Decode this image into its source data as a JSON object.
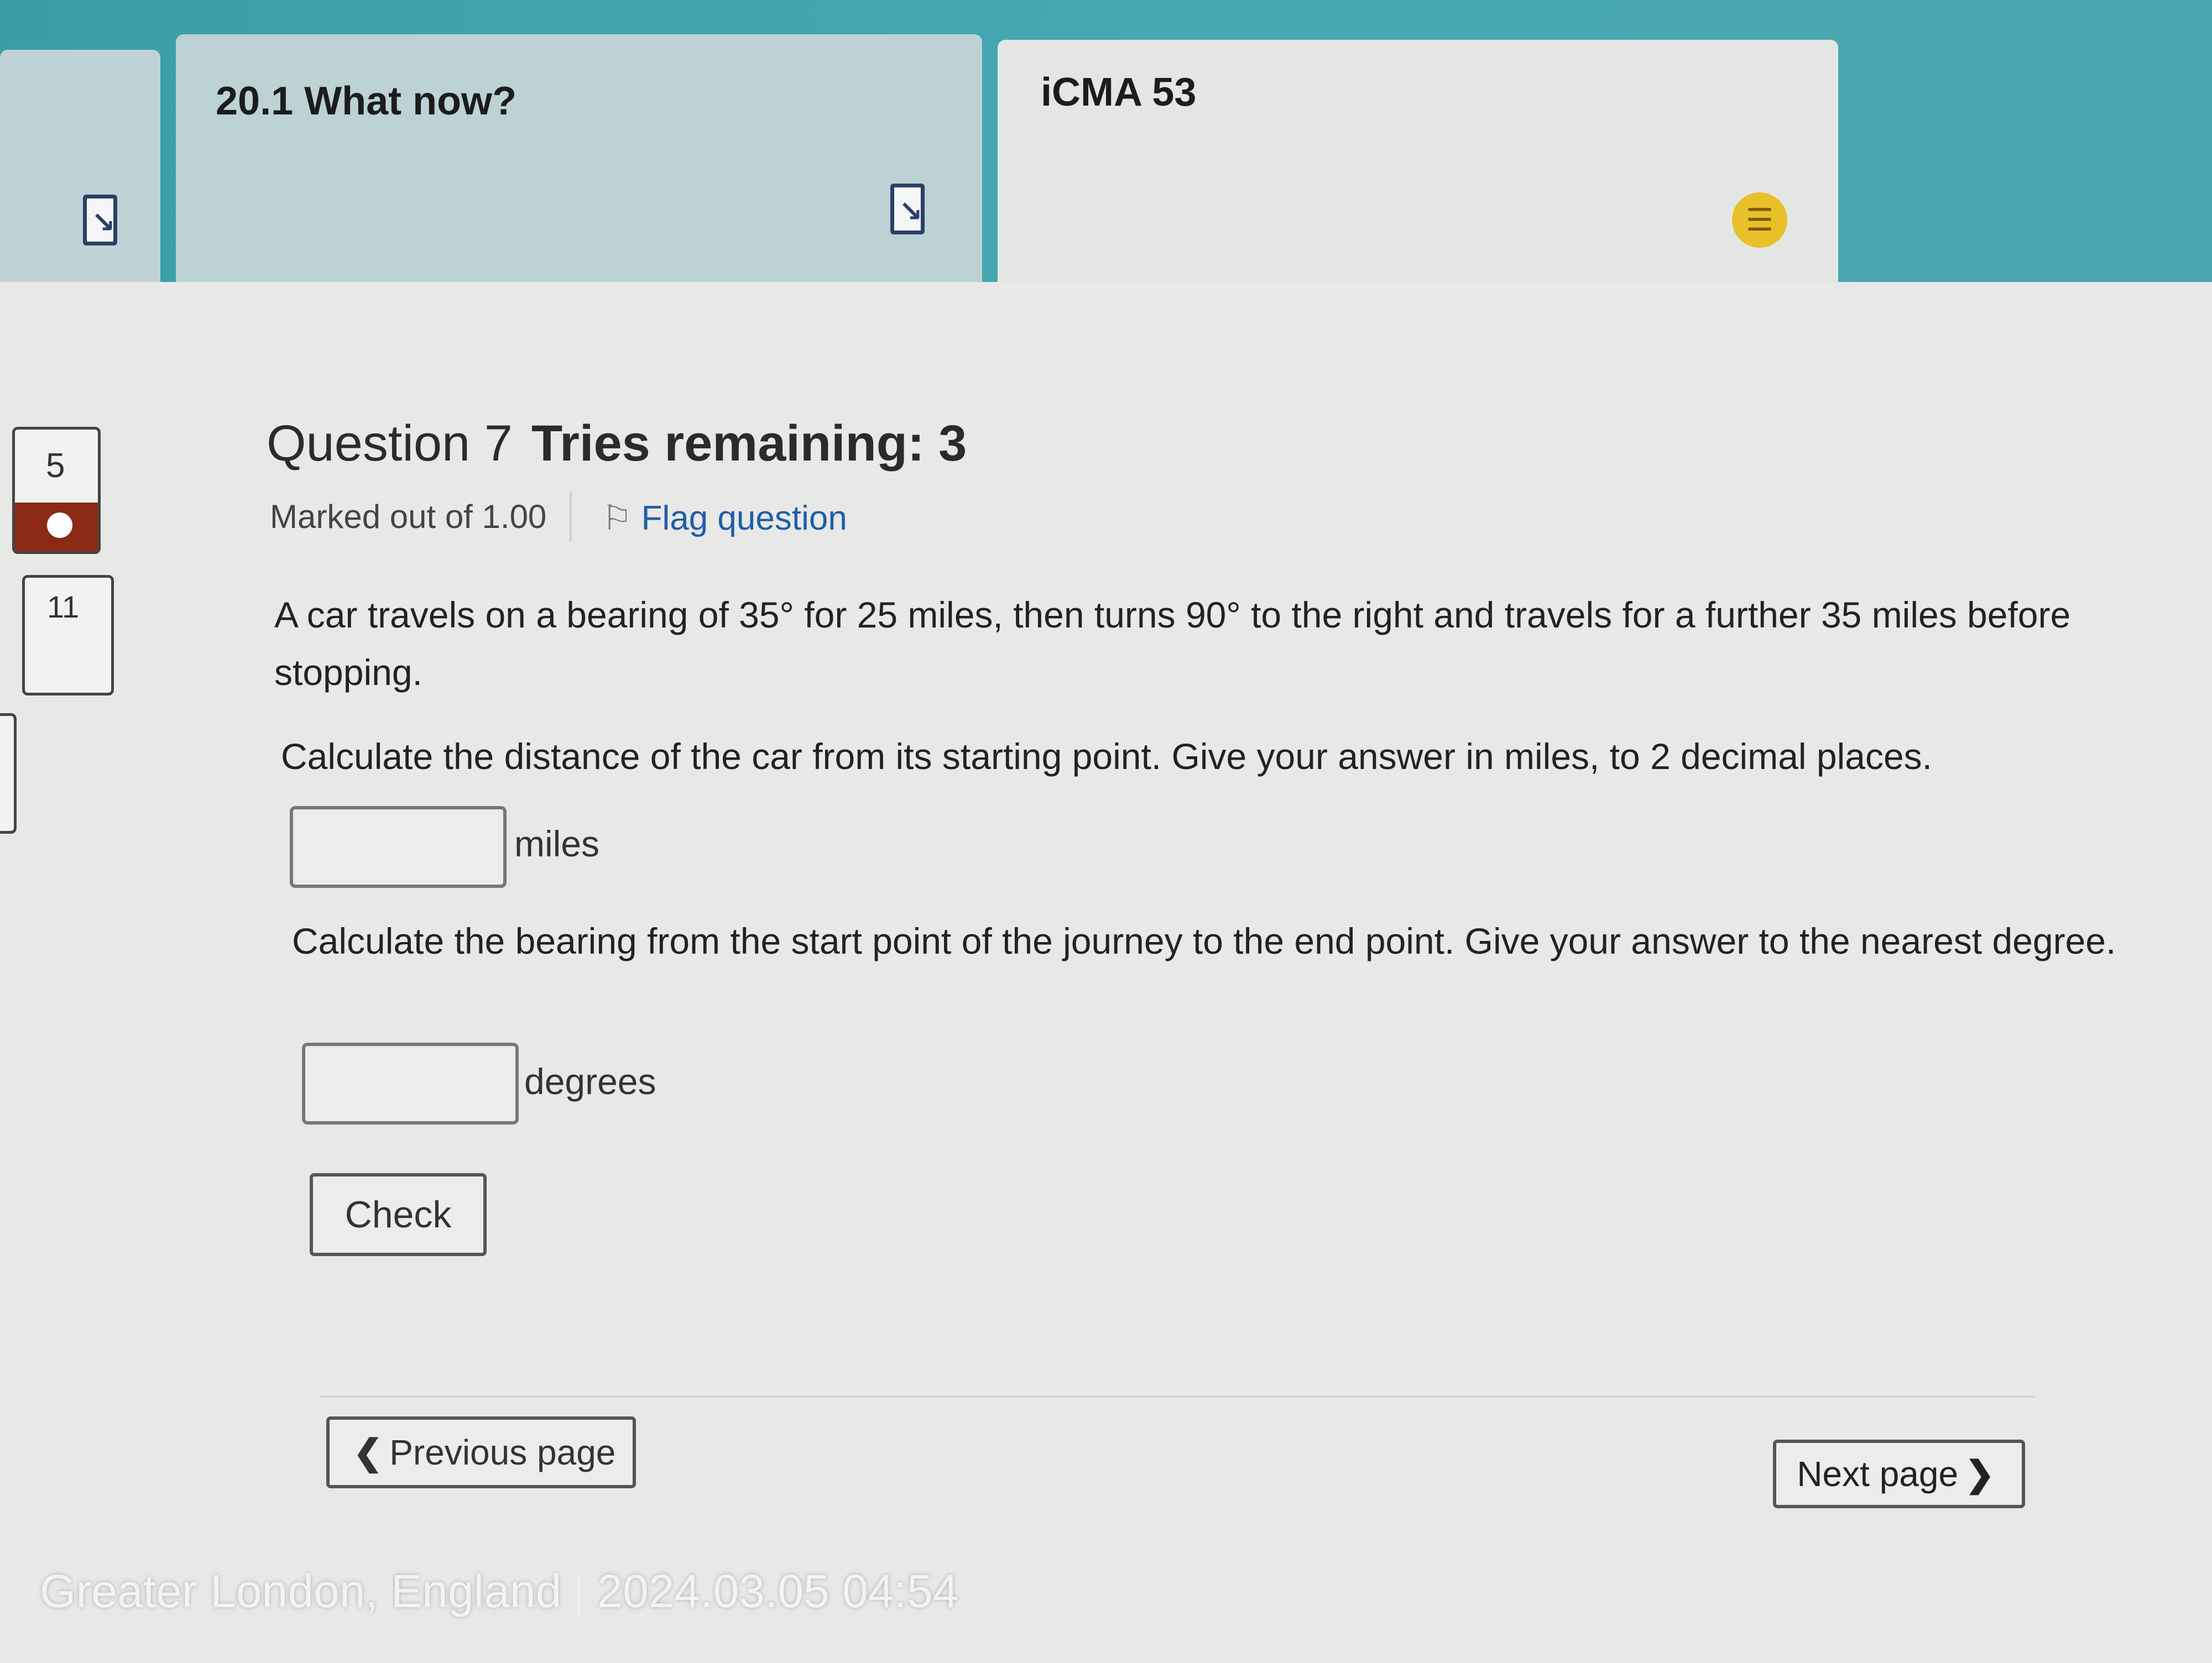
{
  "tabs": [
    {
      "title": "20.1 What now?"
    },
    {
      "title": "iCMA 53"
    }
  ],
  "icons": {
    "document": "document-link-icon",
    "quiz": "quiz-icon",
    "flag": "flag-icon"
  },
  "nav": {
    "items": [
      {
        "number": "5",
        "flagged": true
      },
      {
        "number": "11",
        "flagged": false
      }
    ]
  },
  "question": {
    "title": "Question 7",
    "tries": "Tries remaining: 3",
    "marked": "Marked out of 1.00",
    "flag_label": "Flag question",
    "paragraph1": "A car travels on a bearing of 35° for 25 miles, then turns 90° to the right and travels for a further 35 miles before stopping.",
    "paragraph2": "Calculate the distance of the car from its starting point. Give your answer in miles, to 2 decimal places.",
    "answer1": {
      "value": "",
      "unit": "miles"
    },
    "paragraph3": "Calculate the bearing from the start point of the journey to the end point. Give your answer to the nearest degree.",
    "answer2": {
      "value": "",
      "unit": "degrees"
    },
    "check_label": "Check"
  },
  "pager": {
    "prev_label": "Previous page",
    "next_label": "Next page"
  },
  "stamp": {
    "location": "Greater London, England",
    "datetime": "2024.03.05 04:54"
  },
  "colors": {
    "teal_band": "#48a9b2",
    "flag_bar": "#8a2a14",
    "link": "#1f5ea8",
    "quiz_icon": "#e8c02a"
  }
}
